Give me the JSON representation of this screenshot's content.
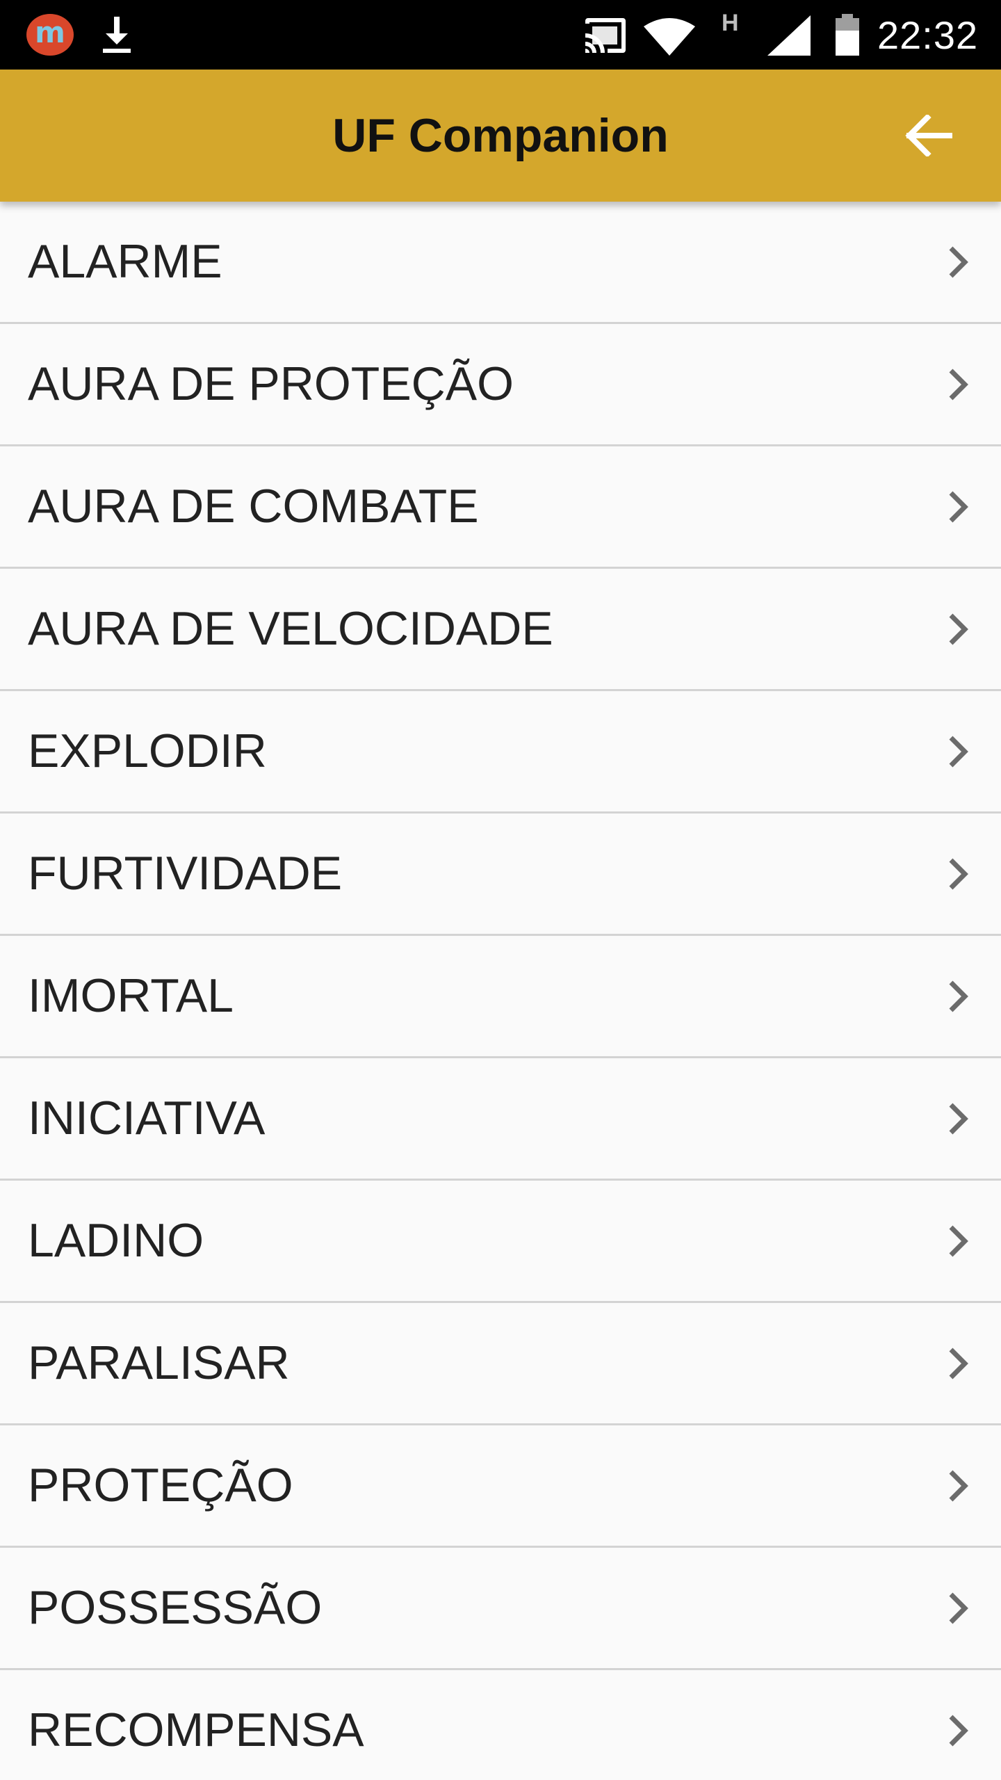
{
  "status_bar": {
    "time": "22:32",
    "app_badge": "m",
    "network_type": "H",
    "icons": [
      "app-notification-icon",
      "download-icon",
      "cast-icon",
      "wifi-icon",
      "cell-signal-icon",
      "battery-icon"
    ]
  },
  "app_bar": {
    "title": "UF Companion",
    "back_icon": "arrow-back-icon",
    "background_color": "#d4a72c"
  },
  "list": {
    "chevron_icon": "chevron-right-icon",
    "items": [
      {
        "label": "ALARME"
      },
      {
        "label": "AURA DE PROTEÇÃO"
      },
      {
        "label": "AURA DE COMBATE"
      },
      {
        "label": "AURA DE VELOCIDADE"
      },
      {
        "label": "EXPLODIR"
      },
      {
        "label": "FURTIVIDADE"
      },
      {
        "label": "IMORTAL"
      },
      {
        "label": "INICIATIVA"
      },
      {
        "label": "LADINO"
      },
      {
        "label": "PARALISAR"
      },
      {
        "label": "PROTEÇÃO"
      },
      {
        "label": "POSSESSÃO"
      },
      {
        "label": "RECOMPENSA"
      }
    ]
  }
}
